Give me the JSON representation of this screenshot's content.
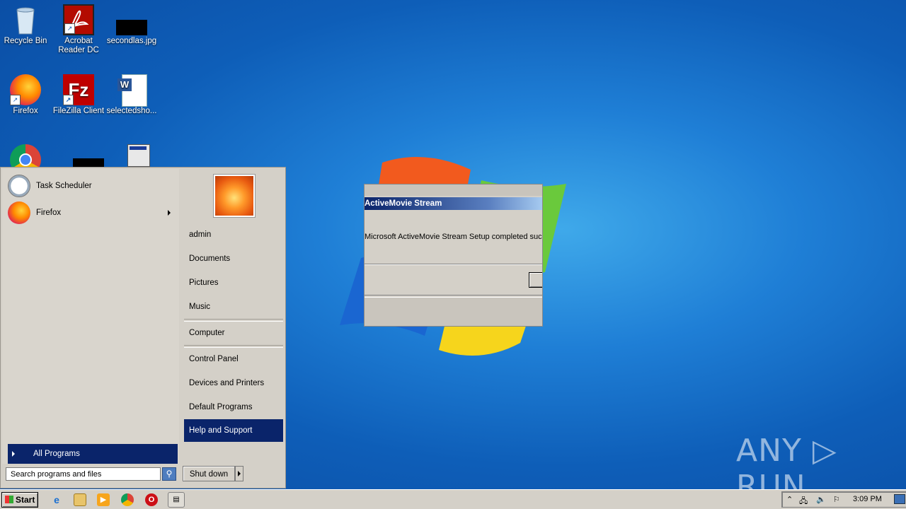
{
  "desktop": {
    "icons": [
      {
        "label": "Recycle Bin"
      },
      {
        "label": "Acrobat\nReader DC"
      },
      {
        "label": "secondlas.jpg"
      },
      {
        "label": "Firefox"
      },
      {
        "label": "FileZilla Client"
      },
      {
        "label": "selectedsho..."
      }
    ]
  },
  "dialog": {
    "title": "ActiveMovie Stream",
    "message": "Microsoft ActiveMovie Stream Setup completed succ"
  },
  "start_menu": {
    "pinned": [
      {
        "label": "Task Scheduler"
      },
      {
        "label": "Firefox"
      }
    ],
    "all_programs": "All Programs",
    "search_placeholder": "Search programs and files",
    "right": {
      "user": "admin",
      "documents": "Documents",
      "pictures": "Pictures",
      "music": "Music",
      "computer": "Computer",
      "control_panel": "Control Panel",
      "devices": "Devices and Printers",
      "default_programs": "Default Programs",
      "help": "Help and Support"
    },
    "shutdown": "Shut down"
  },
  "taskbar": {
    "start": "Start",
    "clock": "3:09 PM"
  },
  "watermark": "ANY ▷ RUN"
}
